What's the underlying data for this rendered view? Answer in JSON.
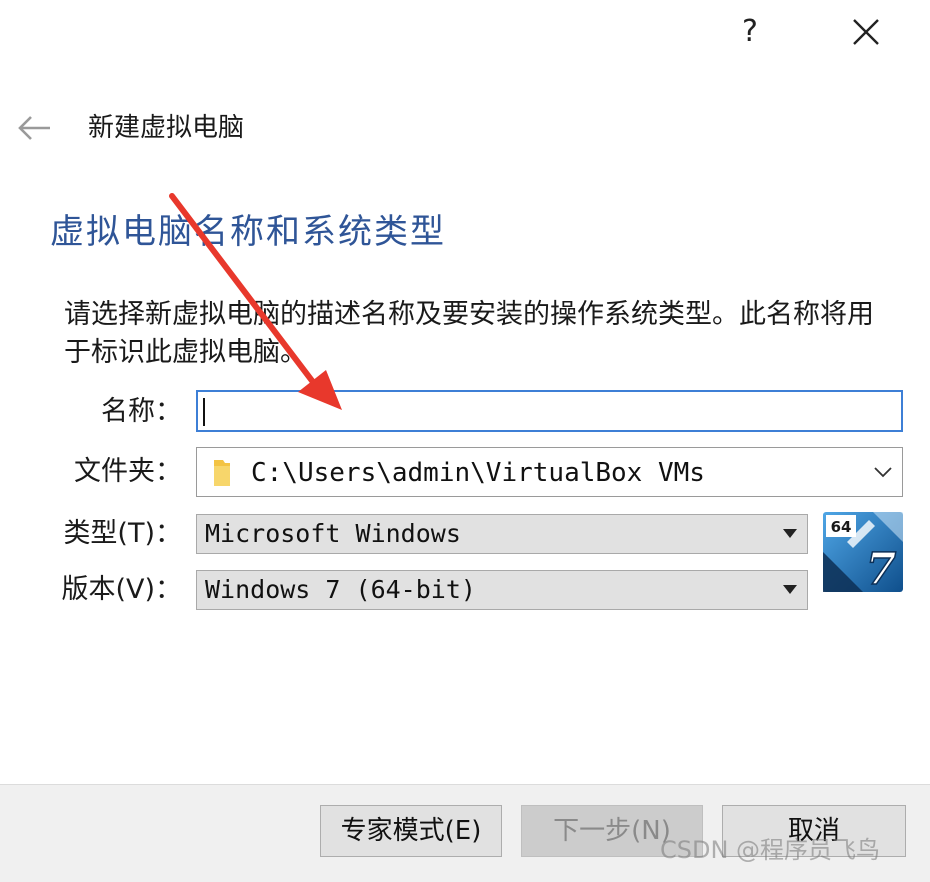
{
  "titlebar": {
    "help_label": "?"
  },
  "header": {
    "title": "新建虚拟电脑"
  },
  "section": {
    "heading": "虚拟电脑名称和系统类型",
    "description": "请选择新虚拟电脑的描述名称及要安装的操作系统类型。此名称将用于标识此虚拟电脑。"
  },
  "form": {
    "name_label": "名称：",
    "name_value": "",
    "folder_label": "文件夹：",
    "folder_value": "C:\\Users\\admin\\VirtualBox VMs",
    "type_label": "类型(T)：",
    "type_value": "Microsoft Windows",
    "version_label": "版本(V)：",
    "version_value": "Windows 7 (64-bit)"
  },
  "os_icon": {
    "badge": "64",
    "number": "7"
  },
  "footer": {
    "expert_label": "专家模式(E)",
    "next_label": "下一步(N)",
    "cancel_label": "取消"
  },
  "watermark": "CSDN @程序员飞鸟",
  "colors": {
    "heading": "#2f5597",
    "focus_border": "#3d7fd6",
    "annotation_arrow": "#e8382c"
  },
  "icons": {
    "back": "back-arrow-icon",
    "close": "close-icon",
    "folder": "folder-icon",
    "chevron": "chevron-down-icon"
  }
}
